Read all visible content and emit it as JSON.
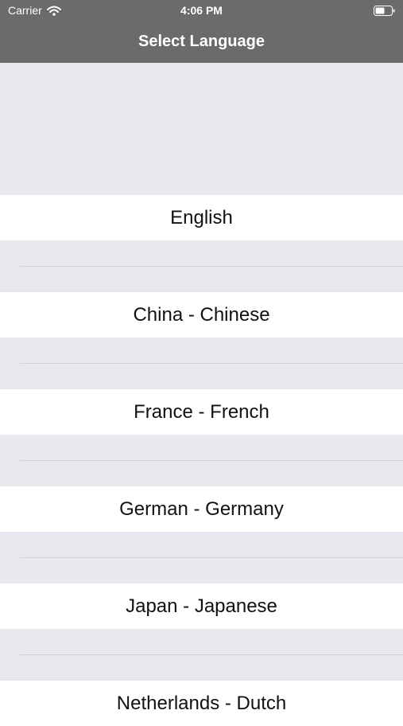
{
  "status_bar": {
    "carrier": "Carrier",
    "time": "4:06 PM",
    "icons": [
      "wifi-icon",
      "battery-icon"
    ]
  },
  "nav": {
    "title": "Select Language"
  },
  "languages": [
    {
      "label": "English"
    },
    {
      "label": "China - Chinese"
    },
    {
      "label": "France - French"
    },
    {
      "label": "German - Germany"
    },
    {
      "label": "Japan - Japanese"
    },
    {
      "label": "Netherlands - Dutch"
    }
  ],
  "colors": {
    "nav_background": "#6b6b6b",
    "list_background": "#e9e8ee",
    "row_background": "#ffffff",
    "text": "#111111"
  }
}
